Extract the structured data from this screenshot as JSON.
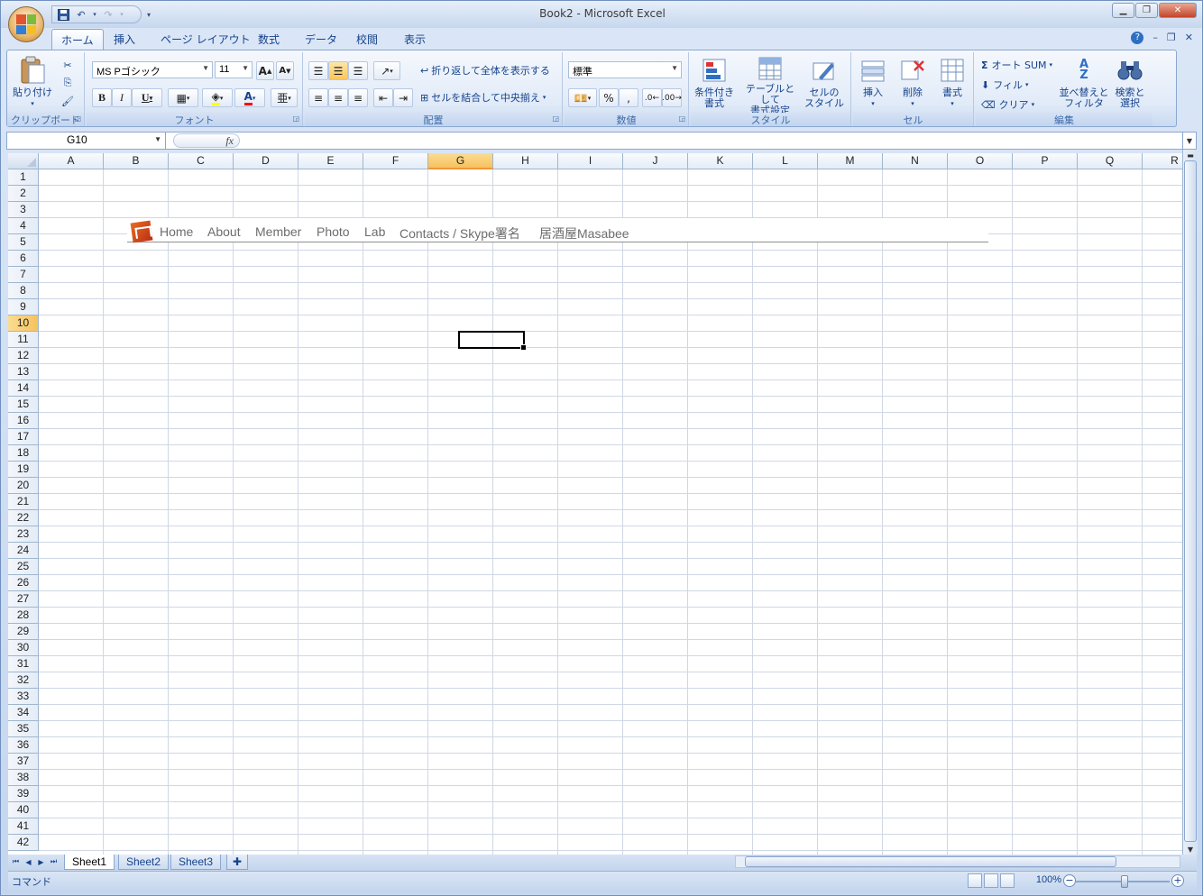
{
  "window": {
    "title": "Book2 - Microsoft Excel"
  },
  "tabs": [
    "ホーム",
    "挿入",
    "ページ レイアウト",
    "数式",
    "データ",
    "校閲",
    "表示"
  ],
  "ribbon": {
    "clipboard": {
      "label": "クリップボード",
      "paste": "貼り付け"
    },
    "font": {
      "label": "フォント",
      "name": "MS Pゴシック",
      "size": "11"
    },
    "alignment": {
      "label": "配置",
      "wrap": "折り返して全体を表示する",
      "merge": "セルを結合して中央揃え"
    },
    "number": {
      "label": "数値",
      "format": "標準"
    },
    "styles": {
      "label": "スタイル",
      "conditional": [
        "条件付き",
        "書式"
      ],
      "table": [
        "テーブルとして",
        "書式設定"
      ],
      "cell": [
        "セルの",
        "スタイル"
      ]
    },
    "cells": {
      "label": "セル",
      "insert": "挿入",
      "delete": "削除",
      "format": "書式"
    },
    "editing": {
      "label": "編集",
      "autosum": "オート SUM",
      "fill": "フィル",
      "clear": "クリア",
      "sort": [
        "並べ替えと",
        "フィルタ"
      ],
      "find": [
        "検索と",
        "選択"
      ]
    }
  },
  "formula_bar": {
    "name_box": "G10",
    "fx": "fx",
    "formula": ""
  },
  "columns": [
    "A",
    "B",
    "C",
    "D",
    "E",
    "F",
    "G",
    "H",
    "I",
    "J",
    "K",
    "L",
    "M",
    "N",
    "O",
    "P",
    "Q",
    "R"
  ],
  "selected_column": "G",
  "selected_row": 10,
  "embedded_nav": {
    "links": [
      "Home",
      "About",
      "Member",
      "Photo",
      "Lab",
      "Contacts / Skype署名",
      "居酒屋Masabee"
    ]
  },
  "sheet_tabs": [
    "Sheet1",
    "Sheet2",
    "Sheet3"
  ],
  "active_sheet": "Sheet1",
  "status": {
    "mode": "コマンド",
    "zoom": "100%"
  }
}
